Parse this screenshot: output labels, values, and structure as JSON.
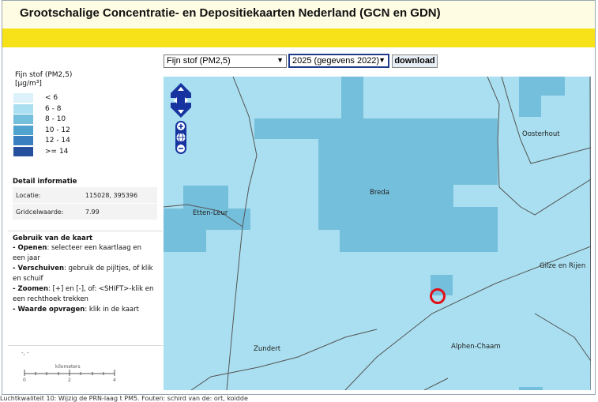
{
  "header": {
    "title": "Grootschalige Concentratie- en Depositiekaarten Nederland (GCN en GDN)"
  },
  "controls": {
    "substance": "Fijn stof (PM2,5)",
    "year": "2025 (gegevens 2022)",
    "download": "download"
  },
  "legend": {
    "title_line1": "Fijn stof (PM2,5)",
    "title_line2": "[µg/m³]",
    "items": [
      {
        "label": "< 6",
        "color": "#dcf1fa"
      },
      {
        "label": "6 - 8",
        "color": "#a9dff0"
      },
      {
        "label": "8 - 10",
        "color": "#74bfdc"
      },
      {
        "label": "10 - 12",
        "color": "#4fa3cf"
      },
      {
        "label": "12 - 14",
        "color": "#3a7fbf"
      },
      {
        "label": ">= 14",
        "color": "#24509d"
      }
    ]
  },
  "detail": {
    "title": "Detail informatie",
    "rows": [
      {
        "key": "Locatie:",
        "value": "115028, 395396"
      },
      {
        "key": "Gridcelwaarde:",
        "value": "7.99"
      }
    ]
  },
  "usage": {
    "title": "Gebruik van de kaart",
    "items": [
      {
        "bold": "- Openen",
        "text": ": selecteer een kaartlaag en een jaar"
      },
      {
        "bold": "- Verschuiven",
        "text": ": gebruik de pijltjes, of klik en schuif"
      },
      {
        "bold": "- Zoomen",
        "text": ": [+] en [-], of: <SHIFT>-klik en een rechthoek trekken"
      },
      {
        "bold": "- Waarde opvragen",
        "text": ": klik in de kaart"
      }
    ]
  },
  "scale": {
    "coord": "-, -",
    "unit": "kilometers",
    "ticks": [
      "0",
      "2",
      "4"
    ]
  },
  "map": {
    "places": {
      "oosterhout": "Oosterhout",
      "breda": "Breda",
      "etten_leur": "Etten-Leur",
      "gilze": "Gilze en Rijen",
      "zundert": "Zundert",
      "alphen": "Alphen-Chaam"
    },
    "marker_color": "#e0101a"
  },
  "footer": {
    "text": "Luchtkwaliteit 10: Wijzig de PRN-laag t PM5. Fouten: schird van de: ort, koidde"
  }
}
